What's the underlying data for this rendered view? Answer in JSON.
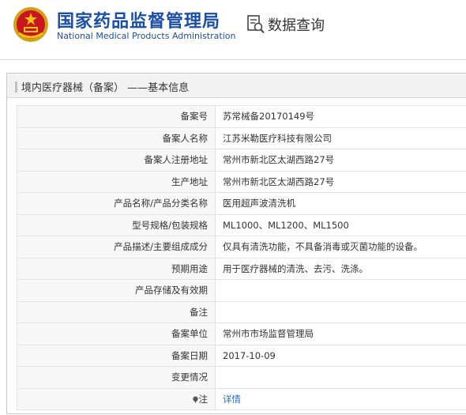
{
  "header": {
    "agency_name_cn": "国家药品监督管理局",
    "agency_name_en": "National Medical Products Administration",
    "query_label": "数据查询"
  },
  "panel": {
    "title": "境内医疗器械（备案） ——基本信息"
  },
  "rows": [
    {
      "label": "备案号",
      "value": "苏常械备20170149号"
    },
    {
      "label": "备案人名称",
      "value": "江苏米勒医疗科技有限公司"
    },
    {
      "label": "备案人注册地址",
      "value": "常州市新北区太湖西路27号"
    },
    {
      "label": "生产地址",
      "value": "常州市新北区太湖西路27号"
    },
    {
      "label": "产品名称/产品分类名称",
      "value": "医用超声波清洗机"
    },
    {
      "label": "型号规格/包装规格",
      "value": "ML1000、ML1200、ML1500"
    },
    {
      "label": "产品描述/主要组成成分",
      "value": "仅具有清洗功能，不具备消毒或灭菌功能的设备。"
    },
    {
      "label": "预期用途",
      "value": "用于医疗器械的清洗、去污、洗涤。"
    },
    {
      "label": "产品存储及有效期",
      "value": ""
    },
    {
      "label": "备注",
      "value": ""
    },
    {
      "label": "备案单位",
      "value": "常州市市场监督管理局"
    },
    {
      "label": "备案日期",
      "value": "2017-10-09"
    },
    {
      "label": "变更情况",
      "value": ""
    },
    {
      "label": "注",
      "value": "详情"
    }
  ]
}
